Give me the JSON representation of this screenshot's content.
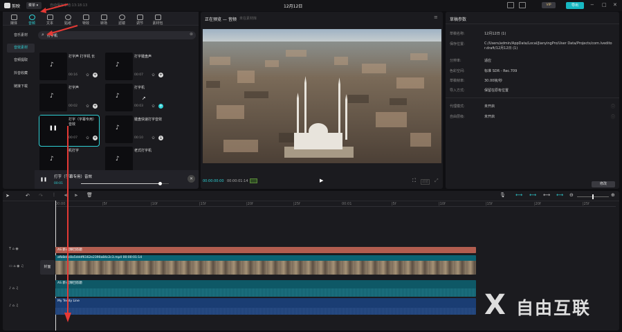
{
  "app": {
    "name": "剪映",
    "menu_label": "菜单",
    "autosave_text": "自动保存本地:13:18:13",
    "project_title": "12月12日",
    "vip_label": "VIP",
    "export_label": "导出"
  },
  "media_tabs": [
    {
      "label": "媒体",
      "icon": "media-icon"
    },
    {
      "label": "音频",
      "icon": "audio-icon"
    },
    {
      "label": "文本",
      "icon": "text-icon"
    },
    {
      "label": "贴纸",
      "icon": "sticker-icon"
    },
    {
      "label": "特效",
      "icon": "effects-icon"
    },
    {
      "label": "转场",
      "icon": "transition-icon"
    },
    {
      "label": "滤镜",
      "icon": "filter-icon"
    },
    {
      "label": "调节",
      "icon": "adjust-icon"
    },
    {
      "label": "素材包",
      "icon": "package-icon"
    }
  ],
  "categories": [
    "音乐素材",
    "音效素材",
    "音频提取",
    "抖音收藏",
    "链接下载"
  ],
  "search": {
    "value": "打字机"
  },
  "sound_cards": [
    {
      "title": "打字声 打字机 长",
      "duration": "00:16"
    },
    {
      "title": "打字键盘声",
      "duration": "00:07"
    },
    {
      "title": "打字声",
      "duration": "00:02"
    },
    {
      "title": "打字机",
      "duration": "00:03"
    },
    {
      "title": "打字（字幕专用）音效",
      "duration": "00:07"
    },
    {
      "title": "键盘快速打字音效",
      "duration": "00:10"
    },
    {
      "title": "机打字",
      "duration": ""
    },
    {
      "title": "老式打字机",
      "duration": ""
    }
  ],
  "player": {
    "title": "打字（字幕专用）音效",
    "time": "00:01",
    "progress": 0.9
  },
  "preview": {
    "header": "正在预览 — 音频",
    "tag": "未在素材库",
    "current_time": "00:00:00:00",
    "total_time": "00:00:01:14",
    "ratio_label": "适配"
  },
  "draft": {
    "heading": "草稿参数",
    "rows": [
      {
        "label": "草稿名称:",
        "value": "12月12日 (1)"
      },
      {
        "label": "保存位置:",
        "value": "C:/Users/admin/AppData/Local/JianyingPro/User Data/Projects/com.lveditor.draft/12月12日 (1)"
      },
      {
        "label": "分辨率:",
        "value": "适应"
      },
      {
        "label": "色彩空间:",
        "value": "标准 SDR - Rec.709"
      },
      {
        "label": "草稿帧率:",
        "value": "30.00帧/秒"
      },
      {
        "label": "导入方式:",
        "value": "保留在原有位置"
      },
      {
        "label": "代理模式:",
        "value": "未开启"
      },
      {
        "label": "自由层级:",
        "value": "未开启"
      }
    ],
    "edit_label": "修改"
  },
  "timeline": {
    "ruler": [
      "00:00",
      "|5f",
      "|10f",
      "|15f",
      "|20f",
      "|25f",
      "00:01",
      "|5f",
      "|10f",
      "|15f",
      "|20f",
      "|25f"
    ],
    "cover_label": "封面",
    "clips": {
      "audio_top": "AS 新·能够回答题",
      "video": "afb8e8c8a5dddf6162e2390a84c2c3.mp4   00:00:01:14",
      "audio_mid": "AS 新·能够回答题",
      "music": "My Teddy Line"
    }
  },
  "watermark": "自由互联",
  "colors": {
    "accent": "#2fd2d6",
    "red_arrow": "#e53935",
    "clip_orange": "#b25d4f",
    "clip_teal": "#0b6373",
    "clip_blue": "#1a3d73"
  }
}
